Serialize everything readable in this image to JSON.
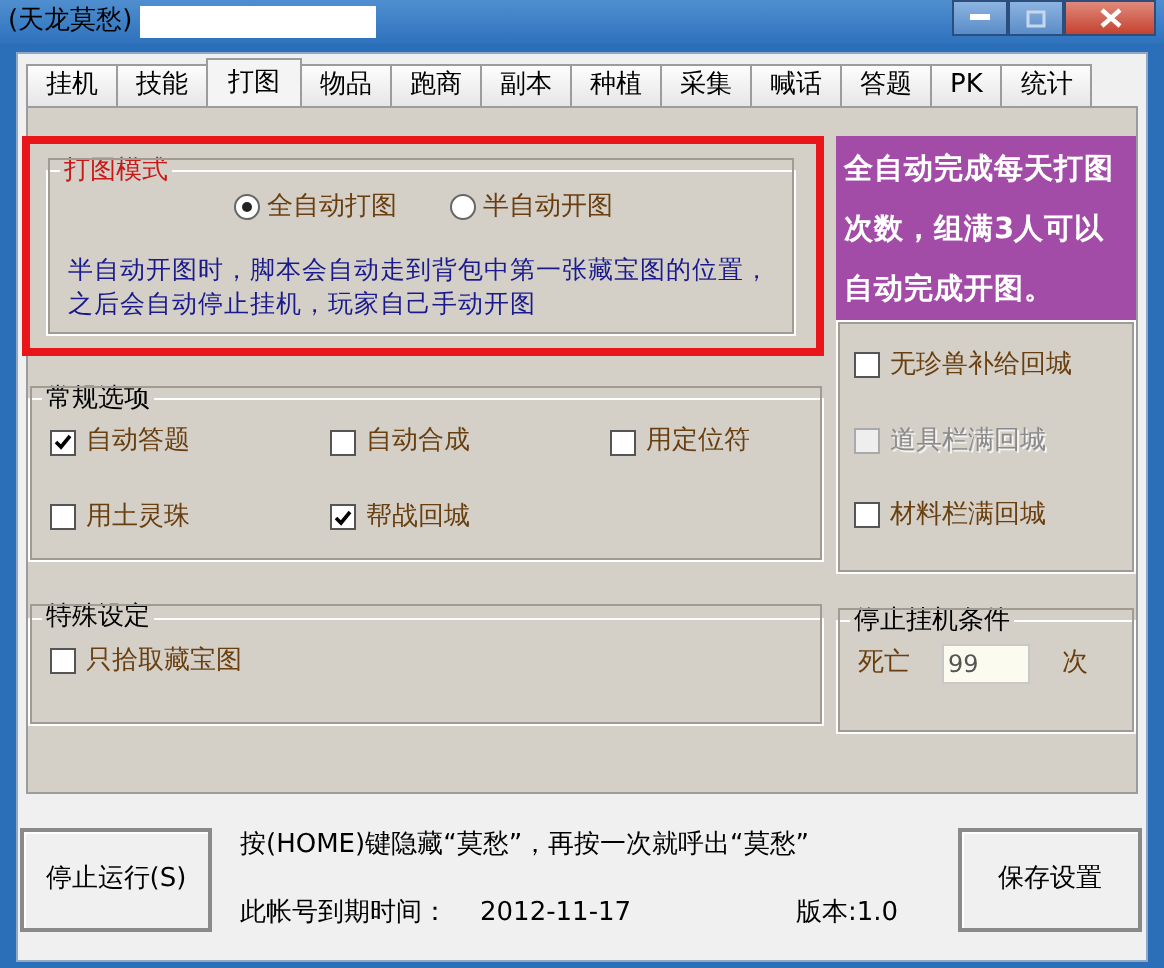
{
  "window": {
    "title": "(天龙莫愁)"
  },
  "tabs": [
    {
      "label": "挂机",
      "selected": false
    },
    {
      "label": "技能",
      "selected": false
    },
    {
      "label": "打图",
      "selected": true
    },
    {
      "label": "物品",
      "selected": false
    },
    {
      "label": "跑商",
      "selected": false
    },
    {
      "label": "副本",
      "selected": false
    },
    {
      "label": "种植",
      "selected": false
    },
    {
      "label": "采集",
      "selected": false
    },
    {
      "label": "喊话",
      "selected": false
    },
    {
      "label": "答题",
      "selected": false
    },
    {
      "label": "PK",
      "selected": false
    },
    {
      "label": "统计",
      "selected": false
    }
  ],
  "map_mode": {
    "title": "打图模式",
    "radios": [
      {
        "label": "全自动打图",
        "selected": true
      },
      {
        "label": "半自动开图",
        "selected": false
      }
    ],
    "note": "半自动开图时，脚本会自动走到背包中第一张藏宝图的位置，之后会自动停止挂机，玩家自己手动开图"
  },
  "promo": "全自动完成每天打图次数，组满3人可以自动完成开图。",
  "return_options": [
    {
      "label": "无珍兽补给回城",
      "checked": false,
      "disabled": false
    },
    {
      "label": "道具栏满回城",
      "checked": false,
      "disabled": true
    },
    {
      "label": "材料栏满回城",
      "checked": false,
      "disabled": false
    }
  ],
  "general": {
    "title": "常规选项",
    "options": [
      {
        "label": "自动答题",
        "checked": true
      },
      {
        "label": "自动合成",
        "checked": false
      },
      {
        "label": "用定位符",
        "checked": false
      },
      {
        "label": "用土灵珠",
        "checked": false
      },
      {
        "label": "帮战回城",
        "checked": true
      }
    ]
  },
  "special": {
    "title": "特殊设定",
    "options": [
      {
        "label": "只拾取藏宝图",
        "checked": false
      }
    ]
  },
  "stop_condition": {
    "title": "停止挂机条件",
    "label": "死亡",
    "value": "99",
    "unit": "次"
  },
  "footer": {
    "stop_button": "停止运行(S)",
    "hint": "按(HOME)键隐藏“莫愁”，再按一次就呼出“莫愁”",
    "expiry_label": "此帐号到期时间：",
    "expiry_date": "2012-11-17",
    "version": "版本:1.0",
    "save_button": "保存设置"
  }
}
